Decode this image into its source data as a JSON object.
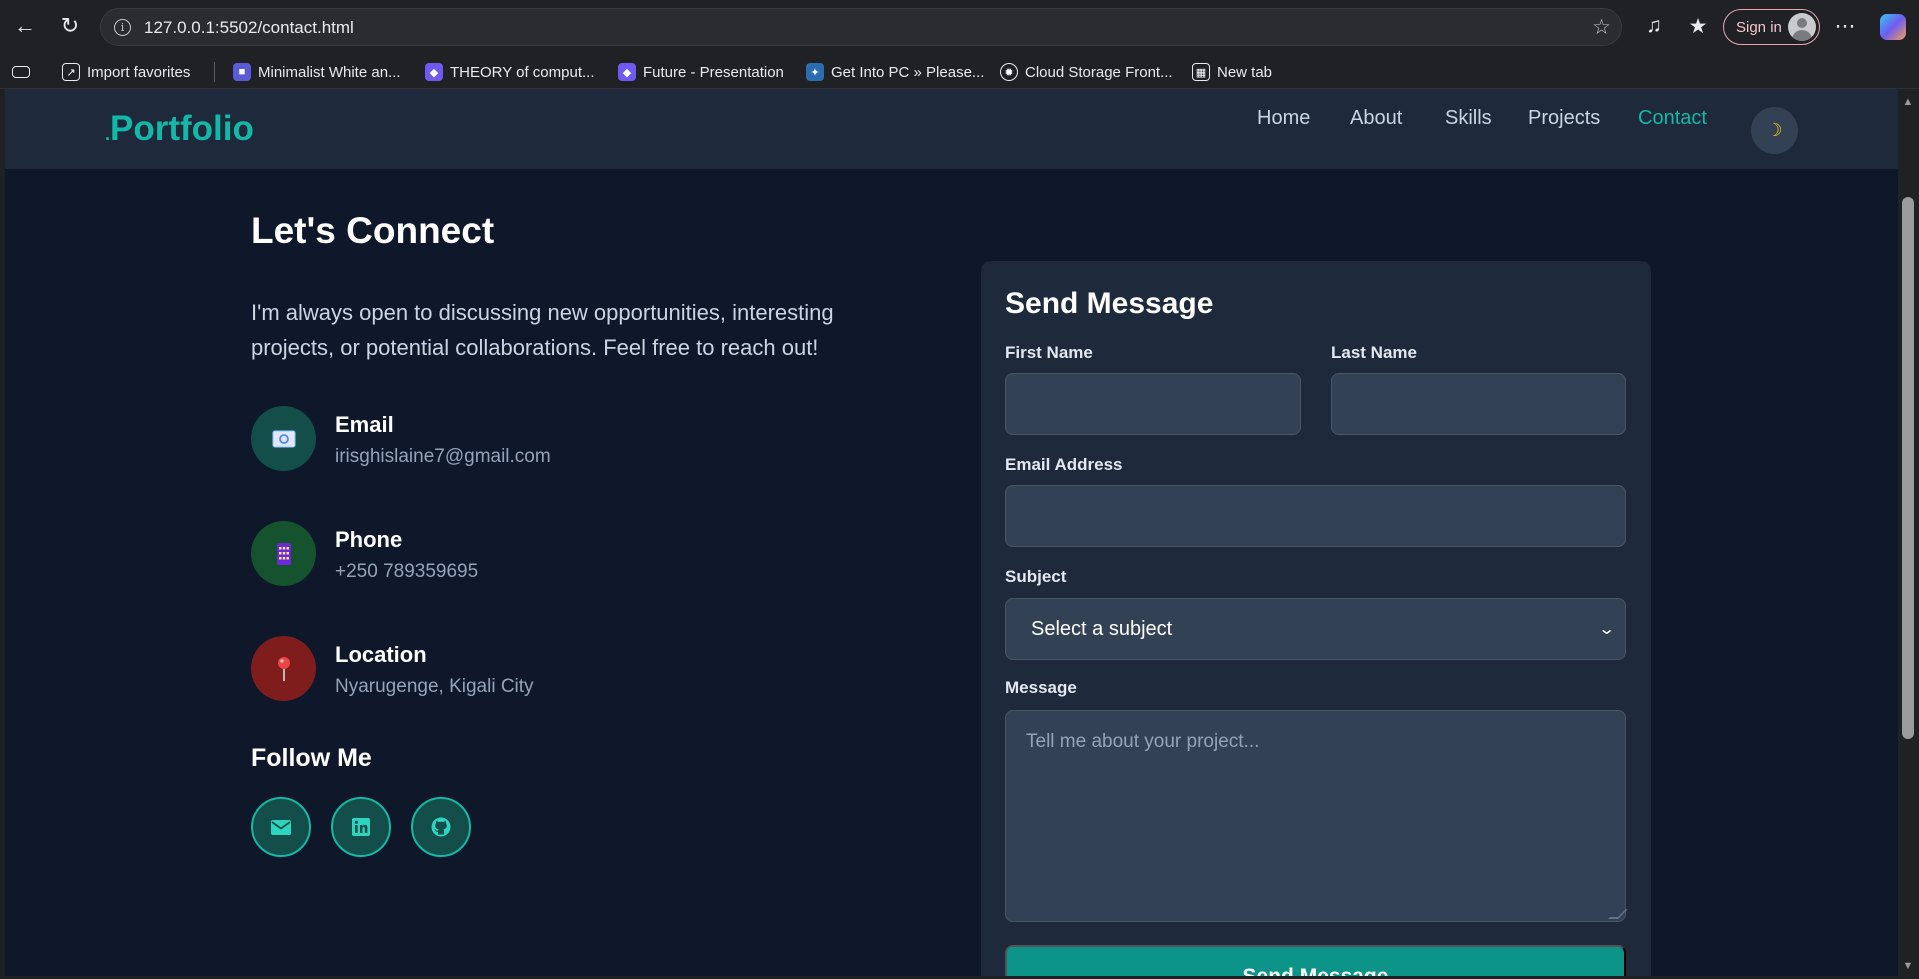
{
  "browser": {
    "url": "127.0.0.1:5502/contact.html",
    "signin_label": "Sign in",
    "bookmarks": [
      {
        "label": "Import favorites",
        "icon": "import-icon"
      },
      {
        "label": "Minimalist White an...",
        "icon": "canva-icon"
      },
      {
        "label": "THEORY of comput...",
        "icon": "copilot-page-icon"
      },
      {
        "label": "Future - Presentation",
        "icon": "copilot-page-icon"
      },
      {
        "label": "Get Into PC » Please...",
        "icon": "getintopc-icon"
      },
      {
        "label": "Cloud Storage Front...",
        "icon": "openai-icon"
      },
      {
        "label": "New tab",
        "icon": "new-tab-icon"
      }
    ]
  },
  "site": {
    "logo_dot": ".",
    "logo": "Portfolio",
    "nav": [
      "Home",
      "About",
      "Skills",
      "Projects",
      "Contact"
    ],
    "active_nav": "Contact",
    "theme_icon": "moon-icon"
  },
  "contact": {
    "title": "Let's Connect",
    "intro": "I'm always open to discussing new opportunities, interesting projects, or potential collaborations. Feel free to reach out!",
    "items": [
      {
        "label": "Email",
        "value": "irisghislaine7@gmail.com",
        "icon": "email-icon",
        "color": "#134e4a"
      },
      {
        "label": "Phone",
        "value": "+250 789359695",
        "icon": "phone-icon",
        "color": "#14532d"
      },
      {
        "label": "Location",
        "value": "Nyarugenge, Kigali City",
        "icon": "pin-icon",
        "color": "#7f1d1d"
      }
    ],
    "follow_title": "Follow Me",
    "socials": [
      "envelope-icon",
      "linkedin-icon",
      "github-icon"
    ]
  },
  "form": {
    "title": "Send Message",
    "first_name_label": "First Name",
    "last_name_label": "Last Name",
    "email_label": "Email Address",
    "subject_label": "Subject",
    "subject_value": "Select a subject",
    "message_label": "Message",
    "message_placeholder": "Tell me about your project...",
    "submit_label": "Send Message"
  },
  "colors": {
    "accent": "#14b8a6",
    "page_bg": "#0f172a",
    "card_bg": "#1e293b",
    "input_bg": "#334155"
  }
}
